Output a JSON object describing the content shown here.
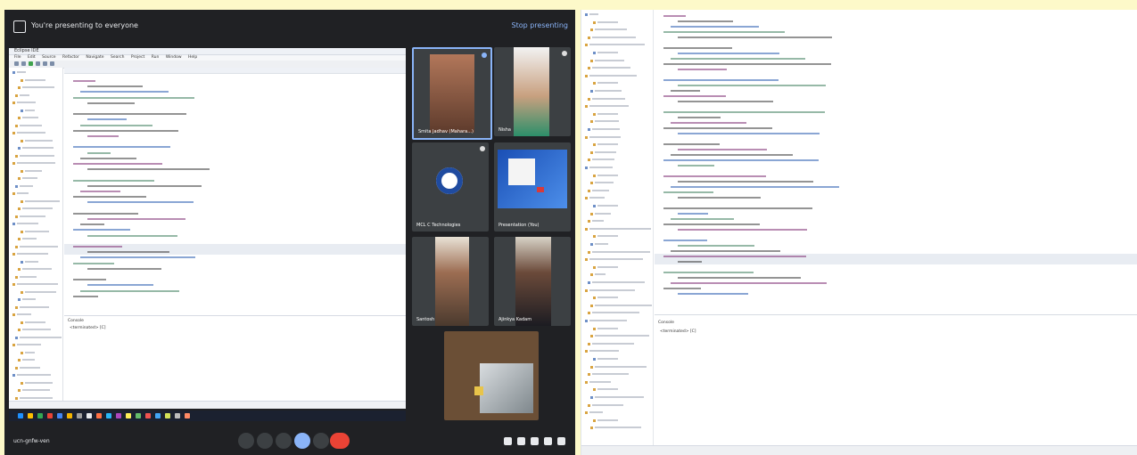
{
  "meet": {
    "banner_text": "You're presenting to everyone",
    "stop_presenting_label": "Stop presenting",
    "meeting_code": "ucn-gnfw-ven",
    "participants": [
      {
        "name": "Smita Jadhav (Mahara...)"
      },
      {
        "name": "Nisha"
      },
      {
        "name": "MCL C Technologies"
      },
      {
        "name": "Presentation (You)"
      },
      {
        "name": "Santosh"
      },
      {
        "name": "Ajinkya Kadam"
      },
      {
        "name": ""
      }
    ]
  },
  "shared_screen": {
    "window_title": "Eclipse IDE",
    "menu": [
      "File",
      "Edit",
      "Source",
      "Refactor",
      "Navigate",
      "Search",
      "Project",
      "Run",
      "Window",
      "Help"
    ],
    "console_tab": "Console",
    "console_output": "<terminated> [C]"
  },
  "ide": {
    "console_tab": "Console",
    "console_output": "<terminated> [C]"
  },
  "colors": {
    "page_background": "#fdf9c9",
    "meet_background": "#202124",
    "end_call": "#ea4335",
    "accent": "#8ab4f8"
  }
}
